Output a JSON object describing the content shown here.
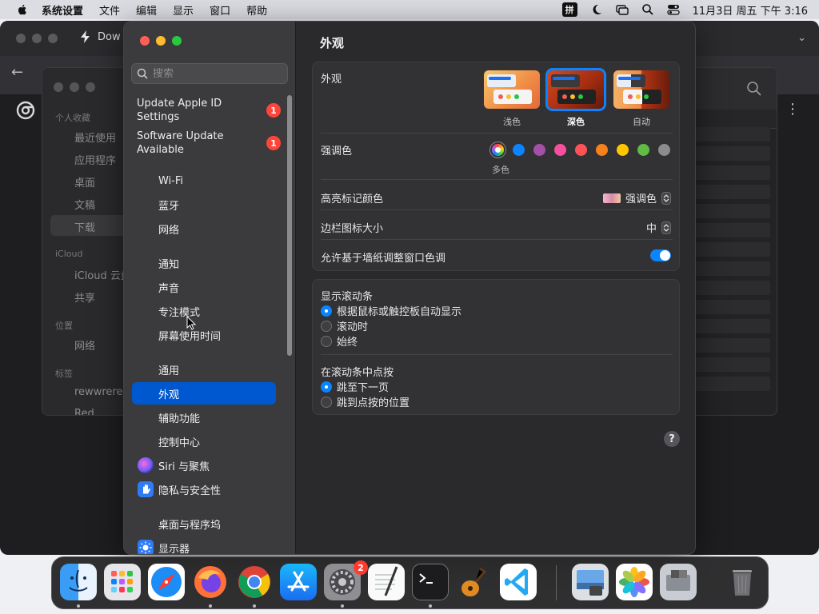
{
  "menubar": {
    "items": [
      "系统设置",
      "文件",
      "编辑",
      "显示",
      "窗口",
      "帮助"
    ],
    "ime": "拼",
    "datetime": "11月3日 周五 下午 3:16"
  },
  "background_browser": {
    "tab_title": "Dow"
  },
  "finder": {
    "section_favorites": "个人收藏",
    "favorites": [
      "最近使用",
      "应用程序",
      "桌面",
      "文稿",
      "下载"
    ],
    "section_icloud": "iCloud",
    "icloud": [
      "iCloud 云盘",
      "共享"
    ],
    "section_locations": "位置",
    "locations": [
      "网络"
    ],
    "section_tags": "标签",
    "tags": [
      "rewwrere",
      "Red"
    ]
  },
  "settings": {
    "search_placeholder": "搜索",
    "updates": [
      {
        "label": "Update Apple ID Settings",
        "badge": "1"
      },
      {
        "label": "Software Update Available",
        "badge": "1"
      }
    ],
    "sidebar_items": [
      "Wi-Fi",
      "蓝牙",
      "网络",
      "通知",
      "声音",
      "专注模式",
      "屏幕使用时间",
      "通用",
      "外观",
      "辅助功能",
      "控制中心",
      "Siri 与聚焦",
      "隐私与安全性",
      "桌面与程序坞",
      "显示器"
    ],
    "selected_item": "外观",
    "title": "外观",
    "appearance": {
      "label": "外观",
      "themes": [
        "浅色",
        "深色",
        "自动"
      ],
      "selected_theme": "深色"
    },
    "accent": {
      "label": "强调色",
      "caption": "多色",
      "colors": [
        "#0a84ff",
        "#a550a7",
        "#f74f9e",
        "#ff5257",
        "#f7821b",
        "#ffc600",
        "#62ba46",
        "#8c8c8c"
      ]
    },
    "highlight": {
      "label": "高亮标记颜色",
      "value": "强调色"
    },
    "sidebar_icon_size": {
      "label": "边栏图标大小",
      "value": "中"
    },
    "wallpaper_tint": {
      "label": "允许基于墙纸调整窗口色调",
      "enabled": true
    },
    "scroll_bars": {
      "title": "显示滚动条",
      "options": [
        "根据鼠标或触控板自动显示",
        "滚动时",
        "始终"
      ],
      "selected": 0
    },
    "click_scroll": {
      "title": "在滚动条中点按",
      "options": [
        "跳至下一页",
        "跳到点按的位置"
      ],
      "selected": 0
    },
    "help_label": "?"
  },
  "dock": {
    "apps": [
      "finder",
      "launchpad",
      "safari",
      "firefox",
      "chrome",
      "app-store",
      "system-settings",
      "textedit",
      "terminal",
      "garageband",
      "vscode",
      "preview",
      "photos",
      "bootcamp-assistant",
      "trash"
    ],
    "settings_badge": "2"
  }
}
